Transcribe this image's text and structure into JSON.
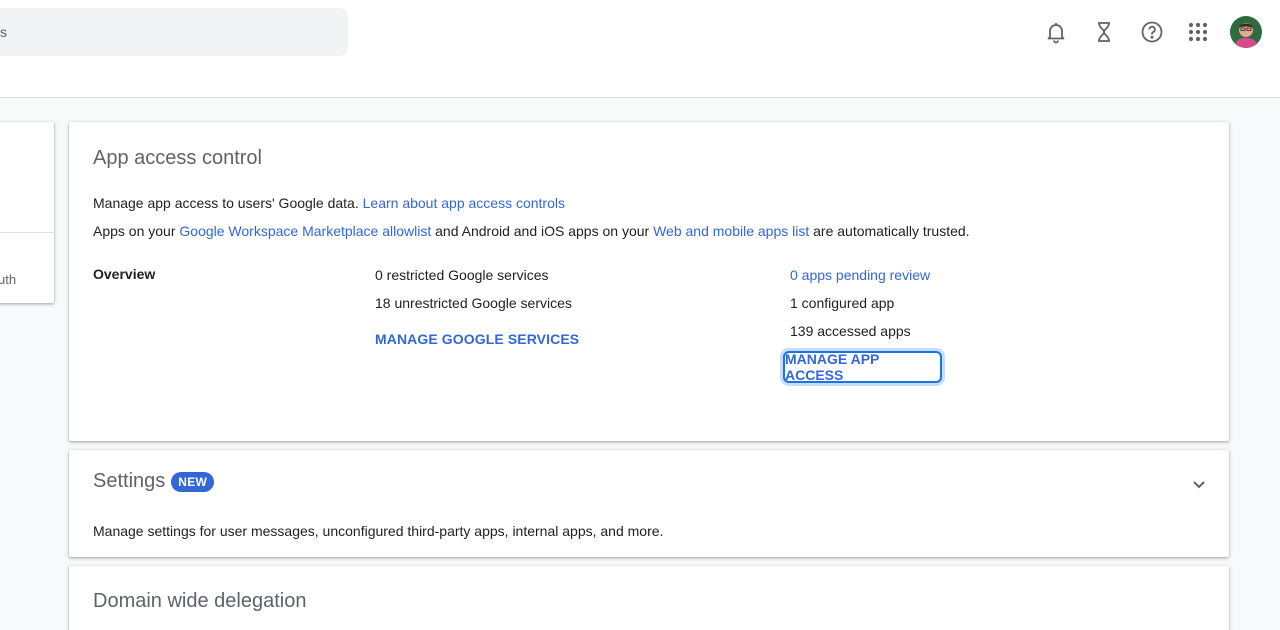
{
  "header": {
    "search_text": "s",
    "icons": [
      "bell-icon",
      "hourglass-icon",
      "help-icon",
      "apps-grid-icon"
    ]
  },
  "left_panel": {
    "partial_text": "uth"
  },
  "app_access": {
    "title": "App access control",
    "line1_text": "Manage app access to users' Google data. ",
    "line1_link": "Learn about app access controls",
    "line2_prefix": "Apps on your ",
    "line2_link1": "Google Workspace Marketplace allowlist",
    "line2_mid": " and Android and iOS apps on your ",
    "line2_link2": "Web and mobile apps list",
    "line2_suffix": " are automatically trusted.",
    "overview_label": "Overview",
    "google_services": {
      "restricted": "0 restricted Google services",
      "unrestricted": "18 unrestricted Google services",
      "manage_button": "MANAGE GOOGLE SERVICES"
    },
    "apps": {
      "pending_review": "0 apps pending review",
      "configured": "1 configured app",
      "accessed": "139 accessed apps",
      "manage_button": "MANAGE APP ACCESS"
    }
  },
  "settings": {
    "title": "Settings",
    "badge": "NEW",
    "description": "Manage settings for user messages, unconfigured third-party apps, internal apps, and more."
  },
  "domain_delegation": {
    "title": "Domain wide delegation"
  },
  "colors": {
    "link": "#3367d6",
    "focus_ring": "#1a73e8",
    "badge_bg": "#3367d6"
  }
}
